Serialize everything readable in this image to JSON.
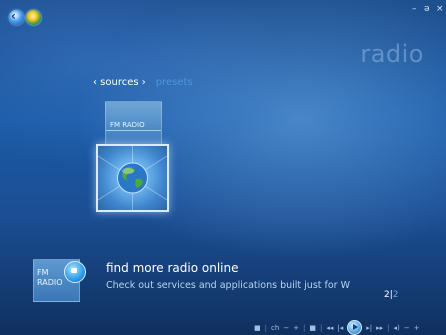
{
  "window": {
    "minimize": "–",
    "restore": "ə",
    "close": "×"
  },
  "page": {
    "watermark": "radio"
  },
  "nav": {
    "sources": "‹ sources ›",
    "presets": "presets"
  },
  "tiles": [
    {
      "label": "FM RADIO"
    }
  ],
  "promo": {
    "icon_line1": "FM",
    "icon_line2": "RADIO",
    "title": "find more radio online",
    "description": "Check out services and applications built just for W"
  },
  "pager": {
    "current": "2",
    "separator": "|",
    "total": "2"
  },
  "transport": {
    "ch_label": "ch",
    "ch_minus": "−",
    "ch_plus": "+",
    "vol_minus": "−",
    "vol_plus": "+"
  },
  "colors": {
    "accent_inactive": "#4f95d8",
    "background_top": "#1e4f8e",
    "background_bottom": "#10305e"
  },
  "icons": [
    "back-icon",
    "start-orb-icon",
    "globe-icon",
    "info-bubble-icon",
    "play-icon",
    "rewind-icon",
    "fast-forward-icon",
    "skip-back-icon",
    "skip-forward-icon",
    "volume-icon"
  ]
}
